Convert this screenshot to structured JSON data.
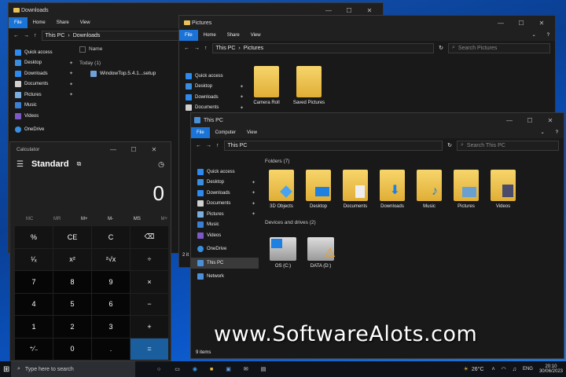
{
  "win_downloads": {
    "title": "Downloads",
    "tabs": [
      "File",
      "Home",
      "Share",
      "View"
    ],
    "breadcrumb": [
      "This PC",
      "Downloads"
    ],
    "nav": [
      {
        "label": "Quick access"
      },
      {
        "label": "Desktop"
      },
      {
        "label": "Downloads"
      },
      {
        "label": "Documents"
      },
      {
        "label": "Pictures"
      },
      {
        "label": "Music"
      },
      {
        "label": "Videos"
      },
      {
        "label": "OneDrive"
      }
    ],
    "col_name": "Name",
    "group": "Today (1)",
    "file": "WindowTop.5.4.1...setup"
  },
  "win_pictures": {
    "title": "Pictures",
    "tabs": [
      "File",
      "Home",
      "Share",
      "View"
    ],
    "breadcrumb": [
      "This PC",
      "Pictures"
    ],
    "search": "Search Pictures",
    "nav": [
      {
        "label": "Quick access"
      },
      {
        "label": "Desktop"
      },
      {
        "label": "Downloads"
      },
      {
        "label": "Documents"
      }
    ],
    "items": [
      {
        "label": "Camera Roll"
      },
      {
        "label": "Saved Pictures"
      }
    ],
    "status": "2 it"
  },
  "win_thispc": {
    "title": "This PC",
    "tabs": [
      "File",
      "Computer",
      "View"
    ],
    "breadcrumb": [
      "This PC"
    ],
    "search": "Search This PC",
    "nav": [
      {
        "label": "Quick access"
      },
      {
        "label": "Desktop"
      },
      {
        "label": "Downloads"
      },
      {
        "label": "Documents"
      },
      {
        "label": "Pictures"
      },
      {
        "label": "Music"
      },
      {
        "label": "Videos"
      },
      {
        "label": "OneDrive"
      },
      {
        "label": "This PC"
      },
      {
        "label": "Network"
      }
    ],
    "folders_hdr": "Folders (7)",
    "folders": [
      {
        "label": "3D Objects"
      },
      {
        "label": "Desktop"
      },
      {
        "label": "Documents"
      },
      {
        "label": "Downloads"
      },
      {
        "label": "Music"
      },
      {
        "label": "Pictures"
      },
      {
        "label": "Videos"
      }
    ],
    "drives_hdr": "Devices and drives (2)",
    "drives": [
      {
        "label": "OS (C:)"
      },
      {
        "label": "DATA (D:)"
      }
    ],
    "status": "9 items"
  },
  "calculator": {
    "title": "Calculator",
    "mode": "Standard",
    "display": "0",
    "memory": [
      "MC",
      "MR",
      "M+",
      "M-",
      "MS",
      "M˅"
    ],
    "keys": [
      "%",
      "CE",
      "C",
      "⌫",
      "¹⁄ₓ",
      "x²",
      "²√x",
      "÷",
      "7",
      "8",
      "9",
      "×",
      "4",
      "5",
      "6",
      "−",
      "1",
      "2",
      "3",
      "+",
      "⁺⁄₋",
      "0",
      ".",
      "="
    ]
  },
  "taskbar": {
    "search": "Type here to search",
    "weather": "26°C",
    "lang": "ENG",
    "time": "20:10",
    "date": "30/06/2023"
  },
  "watermark": "www.SoftwareAlots.com"
}
